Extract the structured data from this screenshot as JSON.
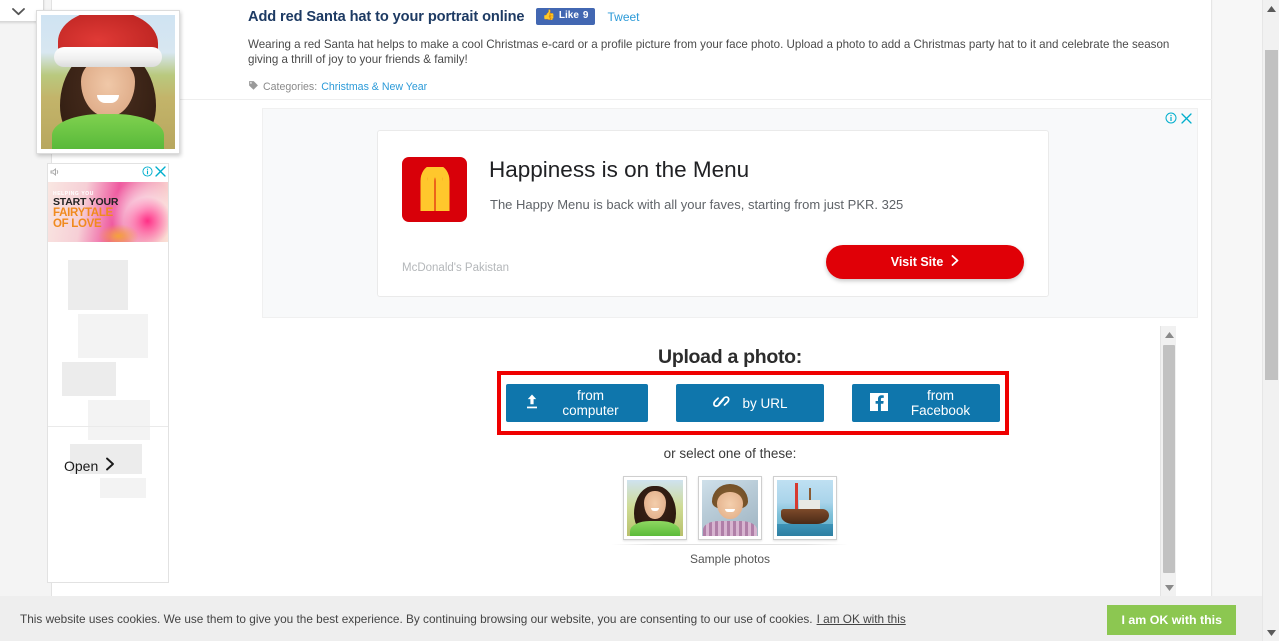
{
  "window": {
    "corner_tab_icon": "chevron-down-icon"
  },
  "article": {
    "title": "Add red Santa hat to your portrait online",
    "like_label": "Like",
    "like_count": "9",
    "tweet_label": "Tweet",
    "description": "Wearing a red Santa hat helps to make a cool Christmas e-card or a profile picture from your face photo. Upload a photo to add a Christmas party hat to it and celebrate the season giving a thrill of joy to your friends & family!",
    "categories_label": "Categories:",
    "category_link": "Christmas & New Year",
    "thumbnail_alt": "santa-hat-portrait-preview"
  },
  "sidebar_ad": {
    "info_icon": "ad-info-icon",
    "close_icon": "ad-close-icon",
    "speaker_icon": "ad-mute-icon",
    "headline_pre": "HELPING YOU",
    "headline_line1": "START YOUR",
    "headline_line2": "FAIRYTALE",
    "headline_line3": "OF LOVE",
    "open_label": "Open",
    "open_arrow_icon": "chevron-right-icon"
  },
  "big_ad": {
    "info_icon": "ad-info-icon",
    "close_icon": "ad-close-icon",
    "logo_name": "mcdonalds-logo",
    "headline": "Happiness is on the Menu",
    "subhead": "The Happy Menu is back with all your faves, starting from just PKR. 325",
    "advertiser": "McDonald's Pakistan",
    "cta_label": "Visit Site",
    "cta_arrow_icon": "chevron-right-icon",
    "cta_color": "#e00007",
    "logo_color": "#d80009"
  },
  "upload": {
    "title": "Upload a photo:",
    "highlight_color": "#ef0000",
    "button_color": "#0f76ac",
    "buttons": [
      {
        "label": "from computer",
        "icon": "upload-icon"
      },
      {
        "label": "by URL",
        "icon": "link-icon"
      },
      {
        "label": "from Facebook",
        "icon": "facebook-icon"
      }
    ],
    "or_select_label": "or select one of these:",
    "samples_label": "Sample photos",
    "samples": [
      {
        "name": "sample-photo-woman"
      },
      {
        "name": "sample-photo-man"
      },
      {
        "name": "sample-photo-boat"
      }
    ]
  },
  "cookie_bar": {
    "text": "This website uses cookies. We use them to give you the best experience. By continuing browsing our website, you are consenting to our use of cookies.",
    "inline_link": "I am OK with this",
    "accept_label": "I am OK with this",
    "accept_color": "#8cc751"
  },
  "scrollbars": {
    "inner_up_icon": "scroll-up-arrow-icon",
    "inner_down_icon": "scroll-down-arrow-icon",
    "outer_up_icon": "scroll-up-arrow-icon",
    "outer_down_icon": "scroll-down-arrow-icon"
  }
}
